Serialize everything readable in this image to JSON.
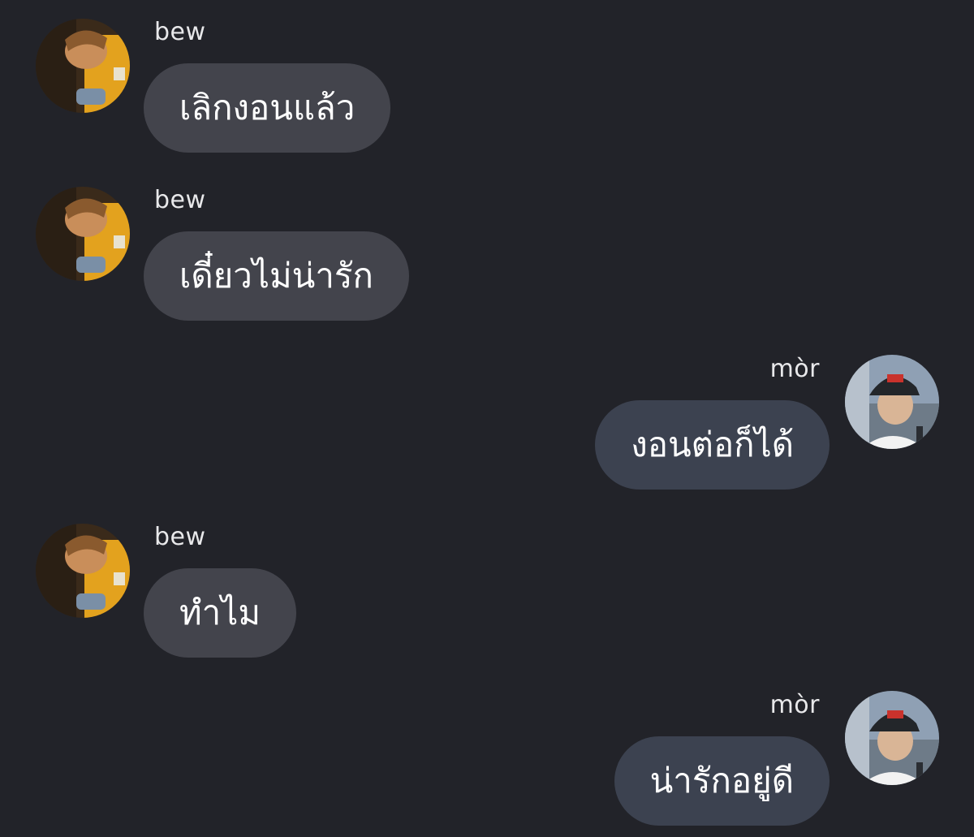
{
  "conversation": {
    "messages": [
      {
        "side": "left",
        "sender": "bew",
        "text": "เลิกงอนแล้ว",
        "avatar": "bew-avatar"
      },
      {
        "side": "left",
        "sender": "bew",
        "text": "เดี๋ยวไม่น่ารัก",
        "avatar": "bew-avatar"
      },
      {
        "side": "right",
        "sender": "mòr",
        "text": "งอนต่อก็ได้",
        "avatar": "mor-avatar"
      },
      {
        "side": "left",
        "sender": "bew",
        "text": "ทำไม",
        "avatar": "bew-avatar"
      },
      {
        "side": "right",
        "sender": "mòr",
        "text": "น่ารักอยู่ดี",
        "avatar": "mor-avatar"
      }
    ]
  },
  "colors": {
    "background": "#222329",
    "incoming_bubble": "#43444c",
    "outgoing_bubble": "#3c4250",
    "text": "#ffffff",
    "sender_text": "#e8e8ea"
  }
}
